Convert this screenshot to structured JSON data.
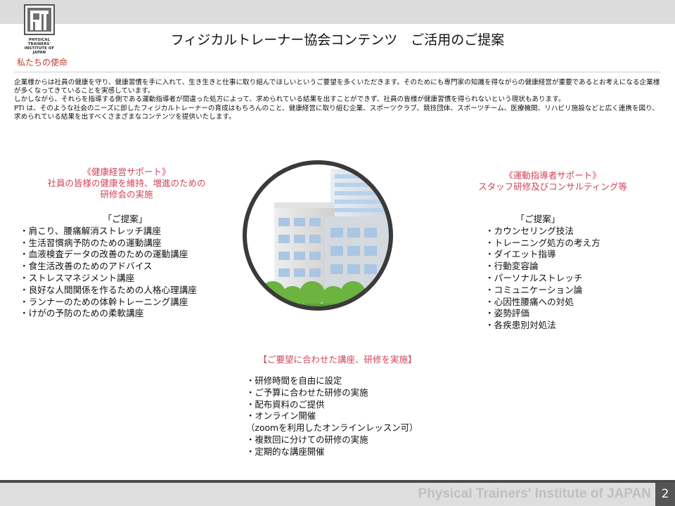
{
  "header": {
    "logo": {
      "line1": "PHYSICAL TRAINERS'",
      "line2": "INSTITUTE OF JAPAN"
    },
    "title": "フィジカルトレーナー協会コンテンツ　ご活用のご提案",
    "section_label": "私たちの使命"
  },
  "intro": {
    "paragraph1": "企業様からは社員の健康を守り、健康習慣を手に入れて、生き生きと仕事に取り組んでほしいというご要望を多くいただきます。そのためにも専門家の知識を得ながらの健康経営が重要であるとお考えになる企業様が多くなってきていることを実感しています。",
    "paragraph2": "しかしながら、それらを指導する側である運動指導者が間違った処方によって、求められている結果を出すことができず、社員の皆様が健康習慣を得られないという現状もあります。",
    "paragraph3": "PTI は、そのような社会のニーズに即したフィジカルトレーナーの育成はもちろんのこと、健康経営に取り組む企業、スポーツクラブ、競技団体、スポーツチーム、医療機関、リハビリ施設などと広く連携を図り、求められている結果を出すべくさまざまなコンテンツを提供いたします。"
  },
  "left": {
    "heading1": "《健康経営サポート》",
    "heading2": "社員の皆様の健康を維持、増進のための",
    "heading3": "研修会の実施",
    "label": "「ご提案」",
    "items": [
      "肩こり、腰痛解消ストレッチ講座",
      "生活習慣病予防のための運動講座",
      "血液検査データの改善のための運動講座",
      "食生活改善のためのアドバイス",
      "ストレスマネジメント講座",
      "良好な人間関係を作るための人格心理講座",
      "ランナーのための体幹トレーニング講座",
      "けがの予防のための柔軟講座"
    ]
  },
  "right": {
    "heading1": "《運動指導者サポート》",
    "heading2": "スタッフ研修及びコンサルティング等",
    "label": "「ご提案」",
    "items": [
      "カウンセリング技法",
      "トレーニング処方の考え方",
      "ダイエット指導",
      "行動変容論",
      "パーソナルストレッチ",
      "コミュニケーション論",
      "心因性腰痛への対処",
      "姿勢評価",
      "各疾患別対処法"
    ]
  },
  "center": {
    "heading": "【ご要望に合わせた講座、研修を実施】",
    "items": [
      "研修時間を自由に設定",
      "ご予算に合わせた研修の実施",
      "配布資料のご提供",
      "オンライン開催"
    ],
    "note": "（zoomを利用したオンラインレッスン可）",
    "items2": [
      "複数回に分けての研修の実施",
      "定期的な講座開催"
    ]
  },
  "footer": {
    "brand": "Physical Trainers' Institute of JAPAN",
    "page_number": "2"
  },
  "icons": {
    "logo": "pti-logo-icon",
    "illustration": "office-buildings-icon"
  },
  "colors": {
    "accent_red": "#d0455a",
    "footer_gray": "#dedede",
    "page_number_bg": "#555555"
  }
}
